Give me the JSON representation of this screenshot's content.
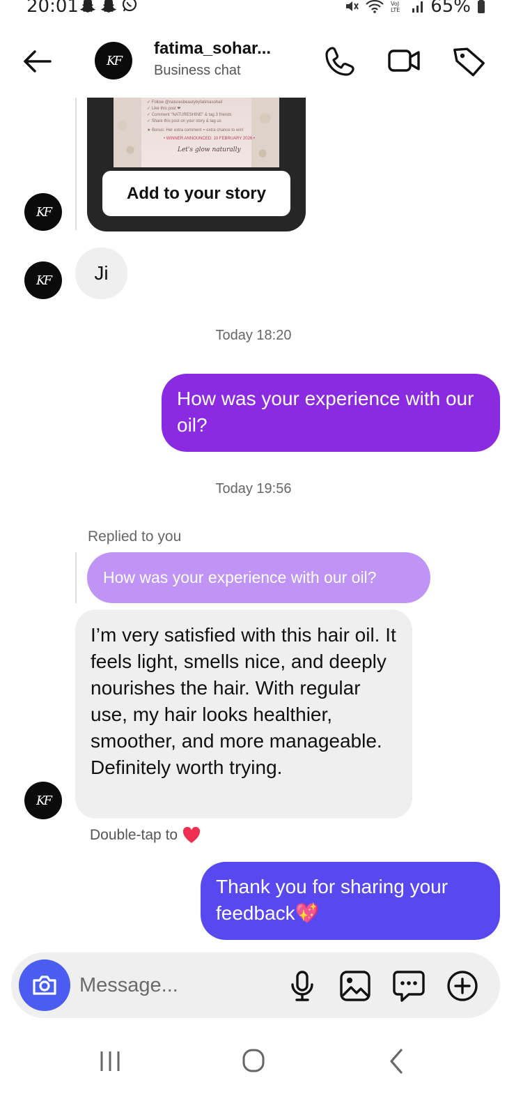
{
  "status_bar": {
    "time": "20:01",
    "battery": "65%"
  },
  "header": {
    "avatar_initials": "KF",
    "username": "fatima_sohar...",
    "subtitle": "Business chat"
  },
  "story_share": {
    "image_lines": [
      "✓ Follow @naturesbeautybyfatimasohail",
      "✓ Like this post ❤",
      "✓ Comment \"NATURESHINE\" & tag 3 friends",
      "✓ Share this post on your story & tag us",
      "★ Bonus: Her extra comment = extra chance to win!",
      "• WINNER ANNOUNCED: 10 FEBRUARY 2026 •",
      "Let's glow naturally"
    ],
    "button_label": "Add to your story"
  },
  "messages": {
    "incoming_short": "Ji",
    "timestamp_1": "Today 18:20",
    "outgoing_1": "How was your experience with our oil?",
    "timestamp_2": "Today 19:56",
    "replied_label": "Replied to you",
    "quoted_text": "How was your experience with our oil?",
    "incoming_long": "I’m very satisfied with this hair oil. It feels light, smells nice, and deeply nourishes the hair. With regular use, my hair looks healthier, smoother, and more manageable. Definitely worth trying.",
    "double_tap_label": "Double-tap to",
    "outgoing_2": "Thank you for sharing your feedback💖"
  },
  "composer": {
    "placeholder": "Message..."
  },
  "colors": {
    "outgoing_purple": "#8a2be2",
    "outgoing_blue": "#5848f0",
    "quoted_lilac": "#bf94f5",
    "camera_blue": "#4a5df0",
    "incoming_gray": "#efefef",
    "heart_red": "#ef2f4f"
  },
  "icons": [
    "back-arrow-icon",
    "phone-icon",
    "video-camera-icon",
    "tag-icon",
    "camera-icon",
    "microphone-icon",
    "gallery-icon",
    "sticker-icon",
    "plus-icon",
    "snapchat-icon",
    "whatsapp-icon",
    "wifi-icon",
    "signal-icon",
    "battery-icon"
  ]
}
